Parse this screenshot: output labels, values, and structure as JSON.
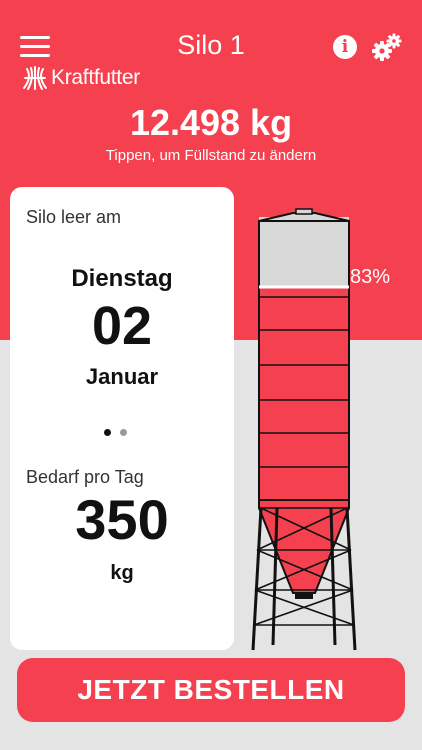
{
  "header": {
    "title": "Silo 1",
    "logo_text": "Kraftfutter",
    "info_label": "i"
  },
  "silo": {
    "weight": "12.498 kg",
    "hint": "Tippen, um Füllstand zu ändern",
    "fill_percent_label": "83%",
    "fill_fraction": 0.83
  },
  "card": {
    "empty_label": "Silo leer am",
    "weekday": "Dienstag",
    "day": "02",
    "month": "Januar",
    "need_label": "Bedarf pro Tag",
    "need_value": "350",
    "need_unit": "kg",
    "pages": 2,
    "active_page": 0
  },
  "order_button": "JETZT BESTELLEN",
  "colors": {
    "accent": "#f5414f",
    "background": "#e4e4e4",
    "card": "#ffffff"
  },
  "icons": [
    "menu-icon",
    "info-icon",
    "gears-icon",
    "kraftfutter-logo-icon"
  ]
}
